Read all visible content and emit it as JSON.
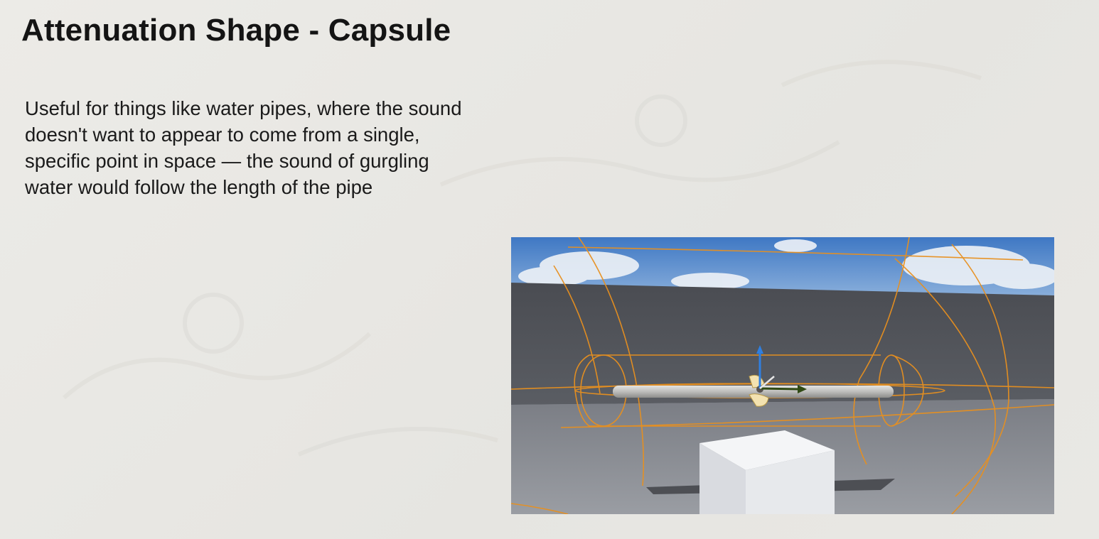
{
  "slide": {
    "title": "Attenuation Shape - Capsule",
    "body": "Useful for things like water pipes, where the sound doesn't want to appear to come from a single, specific point in space — the sound of gurgling water would follow the length of the pipe"
  },
  "viewport_image": {
    "attenuation_wireframe_color": "#e8901f",
    "gizmo_z_axis_color": "#2f7fe0",
    "gizmo_x_axis_color": "#2f4a14",
    "icons": [
      "audio-source-icon",
      "translate-gizmo-icon"
    ]
  }
}
